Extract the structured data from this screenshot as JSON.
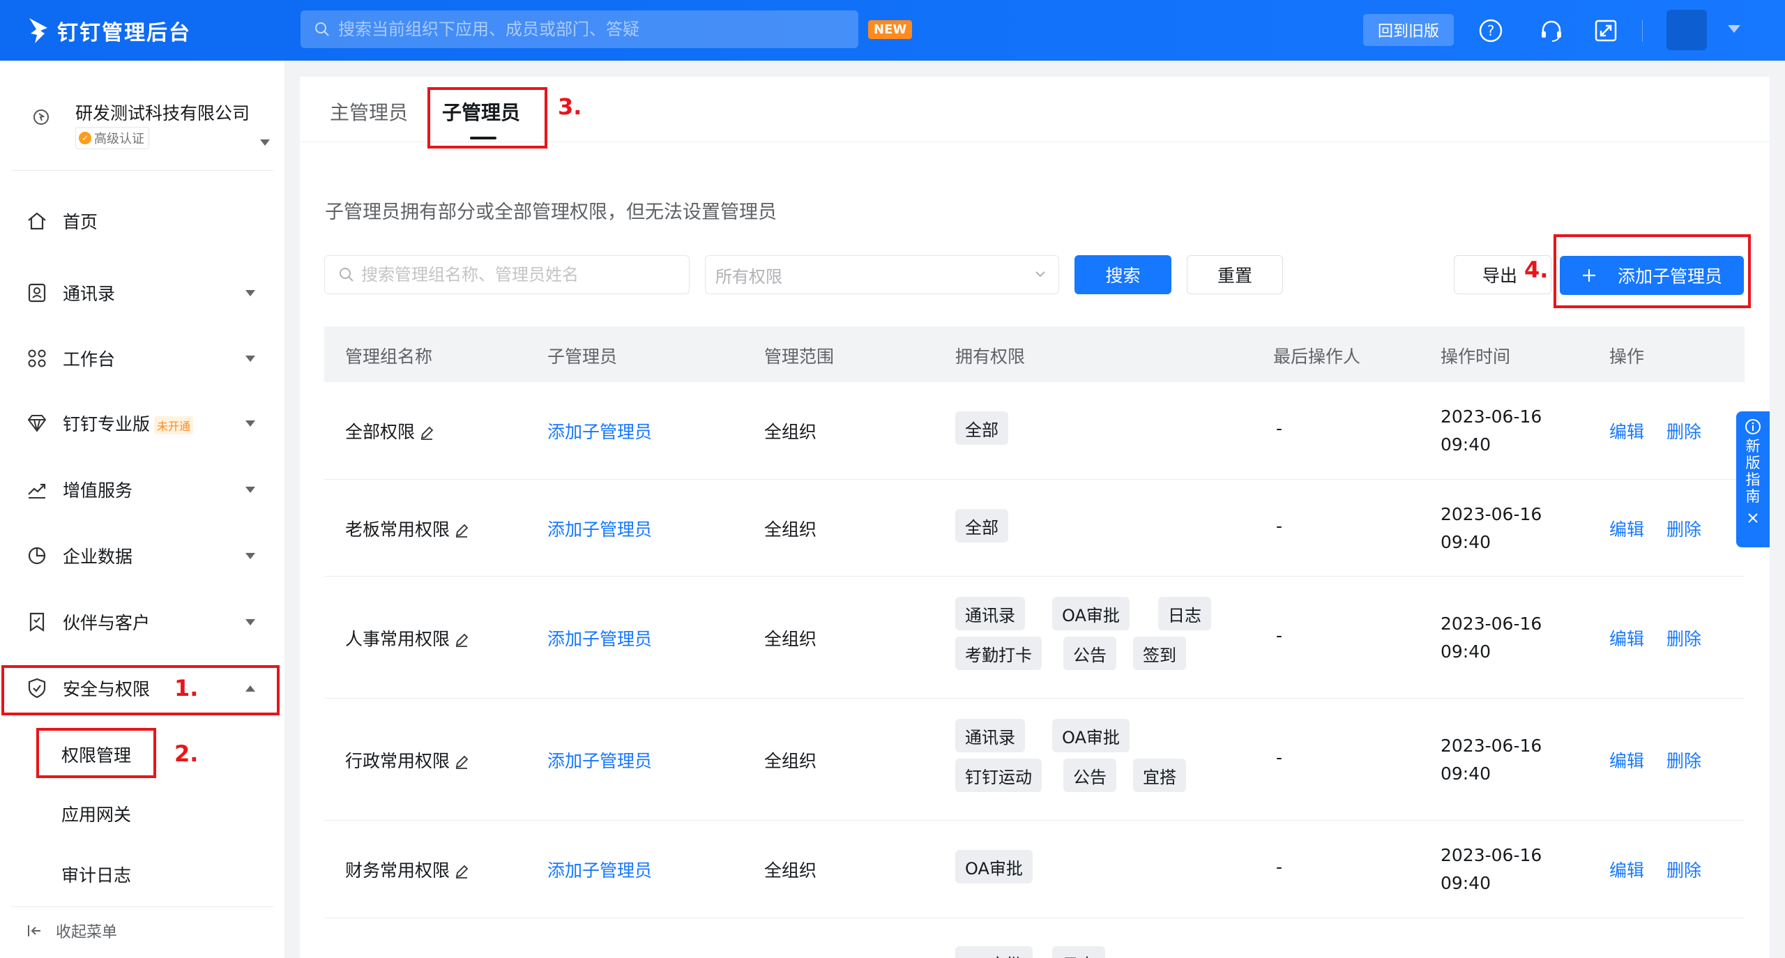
{
  "app": {
    "title": "钉钉管理后台",
    "search_placeholder": "搜索当前组织下应用、成员或部门、答疑",
    "new_badge": "NEW",
    "old_version_btn": "回到旧版"
  },
  "org": {
    "name": "研发测试科技有限公司",
    "badge": "高级认证"
  },
  "sidebar": {
    "items": [
      {
        "label": "首页"
      },
      {
        "label": "通讯录"
      },
      {
        "label": "工作台"
      },
      {
        "label": "钉钉专业版",
        "tag": "未开通"
      },
      {
        "label": "增值服务"
      },
      {
        "label": "企业数据"
      },
      {
        "label": "伙伴与客户"
      },
      {
        "label": "安全与权限"
      }
    ],
    "sub_items": [
      {
        "label": "权限管理"
      },
      {
        "label": "应用网关"
      },
      {
        "label": "审计日志"
      }
    ],
    "collapse_label": "收起菜单"
  },
  "annotations": [
    "1.",
    "2.",
    "3.",
    "4."
  ],
  "main": {
    "tabs": [
      {
        "label": "主管理员"
      },
      {
        "label": "子管理员"
      }
    ],
    "description": "子管理员拥有部分或全部管理权限，但无法设置管理员",
    "filter": {
      "search_placeholder": "搜索管理组名称、管理员姓名",
      "select_value": "所有权限",
      "search_btn": "搜索",
      "reset_btn": "重置",
      "export_btn": "导出",
      "add_btn": "添加子管理员"
    },
    "table": {
      "headers": [
        "管理组名称",
        "子管理员",
        "管理范围",
        "拥有权限",
        "最后操作人",
        "操作时间",
        "操作"
      ],
      "rows": [
        {
          "group": "全部权限",
          "admin": "添加子管理员",
          "scope": "全组织",
          "perms": [
            "全部"
          ],
          "operator": "-",
          "date": "2023-06-16",
          "time": "09:40",
          "edit": "编辑",
          "delete": "删除"
        },
        {
          "group": "老板常用权限",
          "admin": "添加子管理员",
          "scope": "全组织",
          "perms": [
            "全部"
          ],
          "operator": "-",
          "date": "2023-06-16",
          "time": "09:40",
          "edit": "编辑",
          "delete": "删除"
        },
        {
          "group": "人事常用权限",
          "admin": "添加子管理员",
          "scope": "全组织",
          "perms": [
            "通讯录",
            "OA审批",
            "日志",
            "考勤打卡",
            "公告",
            "签到"
          ],
          "operator": "-",
          "date": "2023-06-16",
          "time": "09:40",
          "edit": "编辑",
          "delete": "删除"
        },
        {
          "group": "行政常用权限",
          "admin": "添加子管理员",
          "scope": "全组织",
          "perms": [
            "通讯录",
            "OA审批",
            "钉钉运动",
            "公告",
            "宜搭"
          ],
          "operator": "-",
          "date": "2023-06-16",
          "time": "09:40",
          "edit": "编辑",
          "delete": "删除"
        },
        {
          "group": "财务常用权限",
          "admin": "添加子管理员",
          "scope": "全组织",
          "perms": [
            "OA审批"
          ],
          "operator": "-",
          "date": "2023-06-16",
          "time": "09:40",
          "edit": "编辑",
          "delete": "删除"
        },
        {
          "perms": [
            "OA审批",
            "日志"
          ]
        }
      ]
    }
  },
  "guide": {
    "label": "新版指南"
  }
}
